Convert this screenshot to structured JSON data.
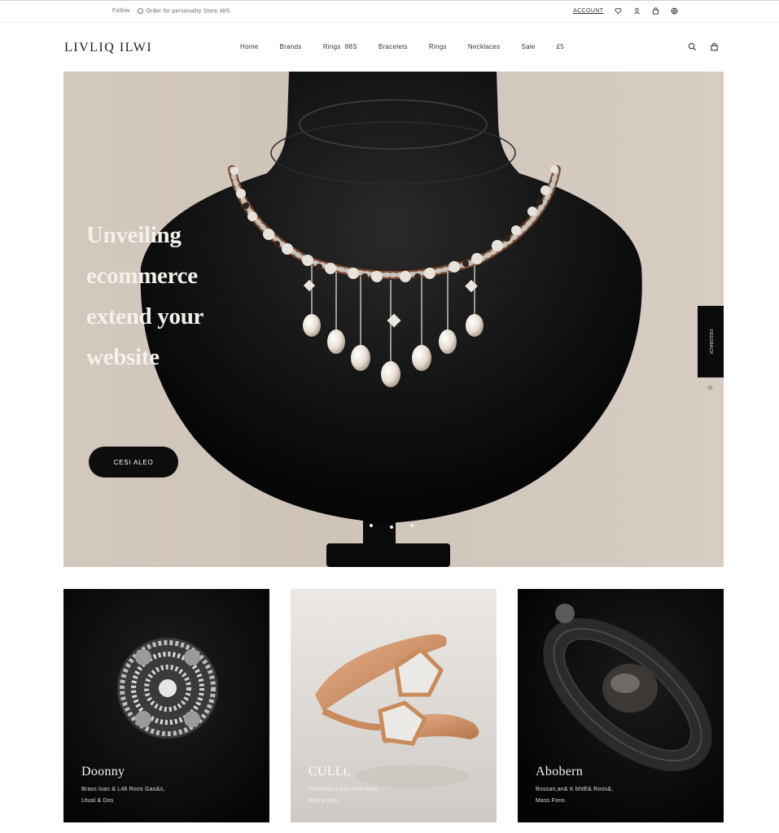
{
  "utility_bar": {
    "left_text_1": "Follow",
    "left_text_2": "Order for personality Store 48S",
    "right_label": "ACCOUNT",
    "icons": [
      "heart-icon",
      "user-icon",
      "bag-icon",
      "globe-icon"
    ]
  },
  "header": {
    "logo": "LIVLIQ ILWI",
    "nav": [
      {
        "label": "Home"
      },
      {
        "label": "Brands"
      },
      {
        "label": "Rings  88S"
      },
      {
        "label": "Bracelets"
      },
      {
        "label": "Rings"
      },
      {
        "label": "Necklaces"
      },
      {
        "label": "Sale"
      },
      {
        "label": "£5"
      }
    ],
    "icons": [
      "search-icon",
      "bag-icon"
    ]
  },
  "hero": {
    "title_lines": [
      "Unveiling",
      "ecommerce",
      "extend your",
      "website"
    ],
    "cta_label": "CESI ALEO",
    "side_tab_label": "FEEDBACK",
    "colors": {
      "background": "#d3c8bd",
      "bust": "#0d0d0d",
      "cta": "#0d0d0d"
    }
  },
  "cards": [
    {
      "title": "Doonny",
      "desc_line_1": "Brass loan & L48 Roos Gao&s,",
      "desc_line_2": "Utual & Dos"
    },
    {
      "title": "CULLt,",
      "desc_line_1": "Kalisaloo a boo Goerdans,",
      "desc_line_2": "Mau a Dao"
    },
    {
      "title": "Abobern",
      "desc_line_1": "Bossan,an& K bhtE& Roos&,",
      "desc_line_2": "Mass Fons"
    }
  ]
}
